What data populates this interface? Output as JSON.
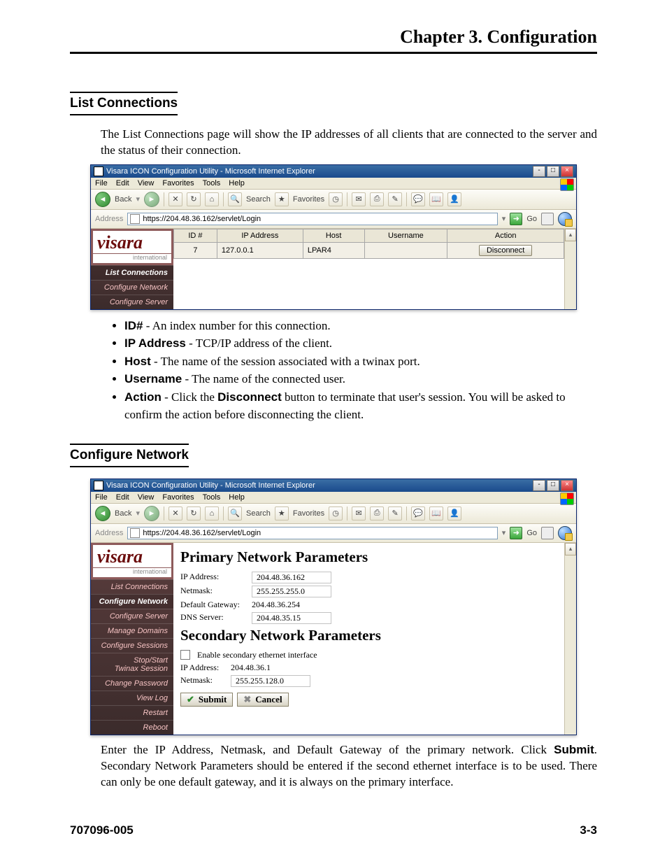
{
  "chapter_header": "Chapter 3.  Configuration",
  "section_list_connections": "List Connections",
  "intro_list": "The List Connections page will show the IP addresses of all clients that are connected to the server and the status of their connection.",
  "browser": {
    "title": "Visara ICON Configuration Utility - Microsoft Internet Explorer",
    "menus": [
      "File",
      "Edit",
      "View",
      "Favorites",
      "Tools",
      "Help"
    ],
    "back": "Back",
    "search": "Search",
    "favorites": "Favorites",
    "address_label": "Address",
    "address": "https://204.48.36.162/servlet/Login",
    "go": "Go",
    "logo": "visara",
    "logo_sub": "international"
  },
  "sidebar1": [
    "List Connections",
    "Configure Network",
    "Configure Server"
  ],
  "conn_table": {
    "headers": [
      "ID #",
      "IP Address",
      "Host",
      "Username",
      "Action"
    ],
    "row": {
      "id": "7",
      "ip": "127.0.0.1",
      "host": "LPAR4",
      "user": "",
      "action": "Disconnect"
    }
  },
  "field_defs": {
    "id": {
      "label": "ID#",
      "text": " - An index number for this connection."
    },
    "ip": {
      "label": "IP Address",
      "text": " - TCP/IP address of the client."
    },
    "host": {
      "label": "Host",
      "text": " - The name of the session associated with a twinax port."
    },
    "user": {
      "label": "Username",
      "text": " - The name of the connected user."
    },
    "action": {
      "label": "Action",
      "text1": " - Click the ",
      "bold": "Disconnect",
      "text2": " button to terminate that user's session. You will be asked to confirm the action before disconnecting the client."
    }
  },
  "section_configure_network": "Configure Network",
  "sidebar2": [
    "List Connections",
    "Configure Network",
    "Configure Server",
    "Manage Domains",
    "Configure Sessions",
    "Stop/Start\nTwinax Session",
    "Change Password",
    "View Log",
    "Restart",
    "Reboot"
  ],
  "net": {
    "h_primary": "Primary Network Parameters",
    "rows_primary": {
      "ip": {
        "lab": "IP Address:",
        "val": "204.48.36.162"
      },
      "mask": {
        "lab": "Netmask:",
        "val": "255.255.255.0"
      },
      "gw": {
        "lab": "Default Gateway:",
        "val": "204.48.36.254"
      },
      "dns": {
        "lab": "DNS Server:",
        "val": "204.48.35.15"
      }
    },
    "h_secondary": "Secondary Network Parameters",
    "enable_secondary": "Enable secondary ethernet interface",
    "rows_secondary": {
      "ip": {
        "lab": "IP Address:",
        "val": "204.48.36.1"
      },
      "mask": {
        "lab": "Netmask:",
        "val": "255.255.128.0"
      }
    },
    "submit": "Submit",
    "cancel": "Cancel"
  },
  "body_after_net": {
    "pre": "Enter the IP Address, Netmask, and Default Gateway of the primary  network. Click ",
    "bold": "Submit",
    "post": ". Secondary Network Parameters should be entered if the second ethernet interface is to be used. There can only be one default gateway, and it is always on the primary interface."
  },
  "footer_left": "707096-005",
  "footer_right": "3-3"
}
